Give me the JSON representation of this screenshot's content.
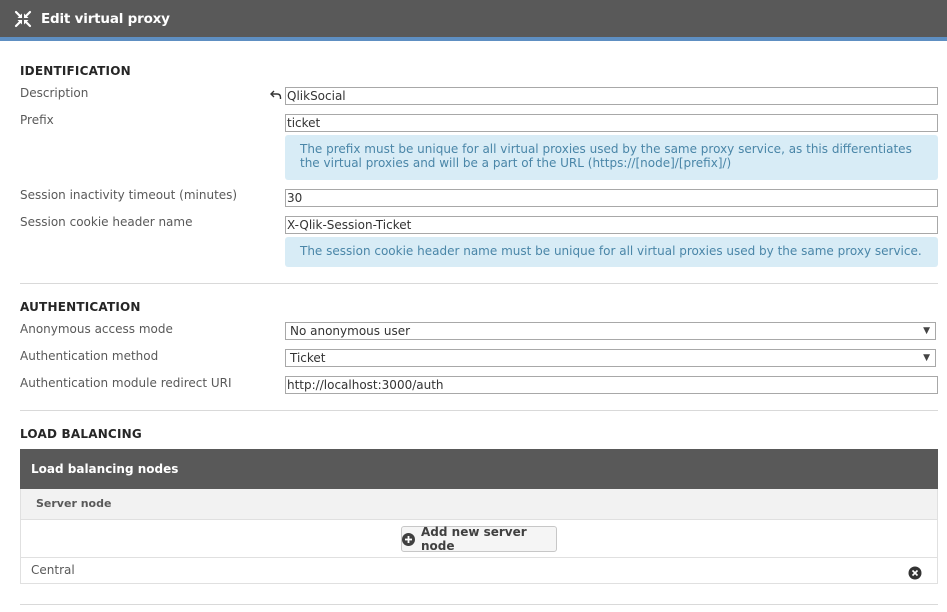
{
  "window": {
    "title": "Edit virtual proxy",
    "icon": "collapse-arrows-icon"
  },
  "identification": {
    "heading": "IDENTIFICATION",
    "description_label": "Description",
    "description_value": "QlikSocial",
    "undo_icon": "undo-arrow-icon",
    "prefix_label": "Prefix",
    "prefix_value": "ticket",
    "prefix_info": "The prefix must be unique for all virtual proxies used by the same proxy service, as this differentiates the virtual proxies and will be a part of the URL (https://[node]/[prefix]/)",
    "timeout_label": "Session inactivity timeout (minutes)",
    "timeout_value": "30",
    "cookie_label": "Session cookie header name",
    "cookie_value": "X-Qlik-Session-Ticket",
    "cookie_info": "The session cookie header name must be unique for all virtual proxies used by the same proxy service."
  },
  "authentication": {
    "heading": "AUTHENTICATION",
    "anon_label": "Anonymous access mode",
    "anon_value": "No anonymous user",
    "method_label": "Authentication method",
    "method_value": "Ticket",
    "redirect_label": "Authentication module redirect URI",
    "redirect_value": "http://localhost:3000/auth"
  },
  "load_balancing": {
    "heading": "LOAD BALANCING",
    "panel_title": "Load balancing nodes",
    "column_header": "Server node",
    "add_button": "Add new server node",
    "nodes": [
      "Central"
    ]
  },
  "colors": {
    "titlebar": "#595959",
    "accent": "#5e8fc2",
    "info_bg": "#d8ecf6",
    "info_text": "#4a86a8"
  }
}
